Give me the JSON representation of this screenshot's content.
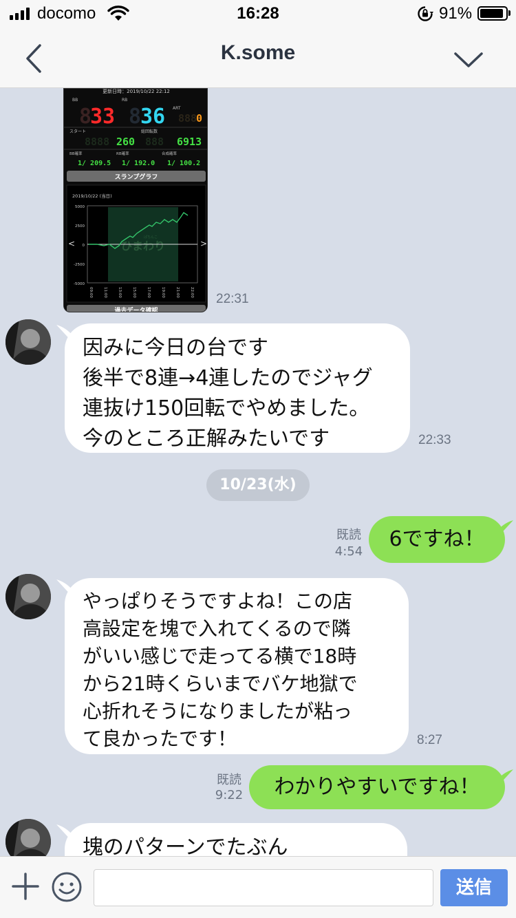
{
  "status_bar": {
    "carrier": "docomo",
    "time": "16:28",
    "battery_percent_text": "91%",
    "battery_level": 0.91,
    "signal_icon": "signal-bars-icon",
    "wifi_icon": "wifi-icon",
    "lock_icon": "rotation-lock-icon"
  },
  "header": {
    "title": "K.some",
    "back_icon": "chevron-left-icon",
    "menu_icon": "chevron-down-icon"
  },
  "image_message": {
    "time": "22:31",
    "screenshot": {
      "update_text": "更新日時：2019/10/22 22:12",
      "bb_label": "BB",
      "bb_value": "33",
      "rb_label": "RB",
      "rb_value": "36",
      "art_label": "ART",
      "art_value": "0",
      "start_label": "スタート",
      "start_value": "260",
      "total_label": "総回転数",
      "total_value": "6913",
      "bb_rate_label": "BB確率",
      "bb_rate": "1/ 209.5",
      "rb_rate_label": "RB確率",
      "rb_rate": "1/ 192.0",
      "combined_rate_label": "合成確率",
      "combined_rate": "1/ 100.2",
      "graph_button": "スランプグラフ",
      "graph_date": "2019/10/22 (当日)",
      "y_ticks": [
        "5000",
        "2500",
        "0",
        "-2500",
        "-5000"
      ],
      "x_ticks": [
        "09:00",
        "11:00",
        "13:00",
        "15:00",
        "17:00",
        "19:00",
        "21:00",
        "22:00"
      ],
      "watermark": "ひまわり",
      "watermark_small": "ぱちんこ",
      "bottom_button": "過去データ確認"
    }
  },
  "messages": [
    {
      "direction": "in",
      "text": "因みに今日の台です\n後半で8連→4連したのでジャグ\n連抜け150回転でやめました。\n今のところ正解みたいです",
      "time": "22:33"
    },
    {
      "direction": "out",
      "text": "6ですね！",
      "read": "既読",
      "time": "4:54"
    },
    {
      "direction": "in",
      "text": "やっぱりそうですよね！この店\n高設定を塊で入れてくるので隣\nがいい感じで走ってる横で18時\nから21時くらいまでバケ地獄で\n心折れそうになりましたが粘っ\nて良かったです！",
      "time": "8:27"
    },
    {
      "direction": "out",
      "text": "わかりやすいですね！",
      "read": "既読",
      "time": "9:22"
    },
    {
      "direction": "in",
      "text": "塊のパターンでたぶん",
      "time": ""
    }
  ],
  "date_separator": "10/23(水)",
  "input_bar": {
    "plus_icon": "plus-icon",
    "emoji_icon": "emoji-icon",
    "placeholder": "",
    "send_label": "送信"
  },
  "colors": {
    "chat_background": "#d7dde8",
    "outgoing_bubble": "#8de055",
    "incoming_bubble": "#ffffff",
    "send_button": "#5b8ee6"
  }
}
